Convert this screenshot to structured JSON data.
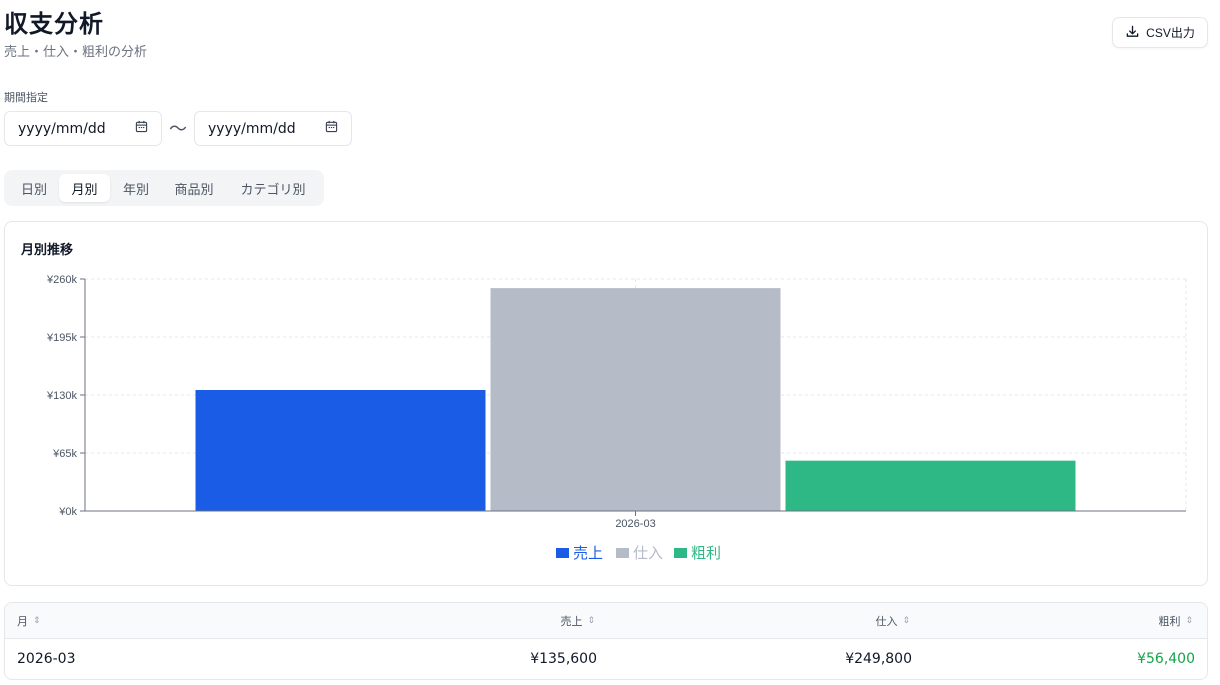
{
  "page": {
    "title": "収支分析",
    "subtitle": "売上・仕入・粗利の分析"
  },
  "toolbar": {
    "csv_label": "CSV出力"
  },
  "filter": {
    "period_label": "期間指定",
    "from_placeholder": "yyyy/mm/dd",
    "to_placeholder": "yyyy/mm/dd",
    "separator": "〜"
  },
  "tabs": [
    {
      "label": "日別",
      "active": false
    },
    {
      "label": "月別",
      "active": true
    },
    {
      "label": "年別",
      "active": false
    },
    {
      "label": "商品別",
      "active": false
    },
    {
      "label": "カテゴリ別",
      "active": false
    }
  ],
  "chart_card": {
    "title": "月別推移"
  },
  "chart_data": {
    "type": "bar",
    "categories": [
      "2026-03"
    ],
    "series": [
      {
        "name": "売上",
        "values": [
          135600
        ],
        "color": "#1a5ce5"
      },
      {
        "name": "仕入",
        "values": [
          249800
        ],
        "color": "#b6bbc8"
      },
      {
        "name": "粗利",
        "values": [
          56400
        ],
        "color": "#2eb886"
      }
    ],
    "y_ticks": [
      "¥0k",
      "¥65k",
      "¥130k",
      "¥195k",
      "¥260k"
    ],
    "y_tick_values": [
      0,
      65000,
      130000,
      195000,
      260000
    ],
    "ylim": [
      0,
      260000
    ],
    "grid": true,
    "legend_position": "bottom-center"
  },
  "table": {
    "columns": [
      "月",
      "売上",
      "仕入",
      "粗利"
    ],
    "rows": [
      [
        "2026-03",
        "¥135,600",
        "¥249,800",
        "¥56,400"
      ]
    ],
    "profit_color": "#16a34a"
  },
  "icons": {
    "download": "download-icon",
    "calendar": "calendar-icon",
    "sort": "sort-icon"
  }
}
